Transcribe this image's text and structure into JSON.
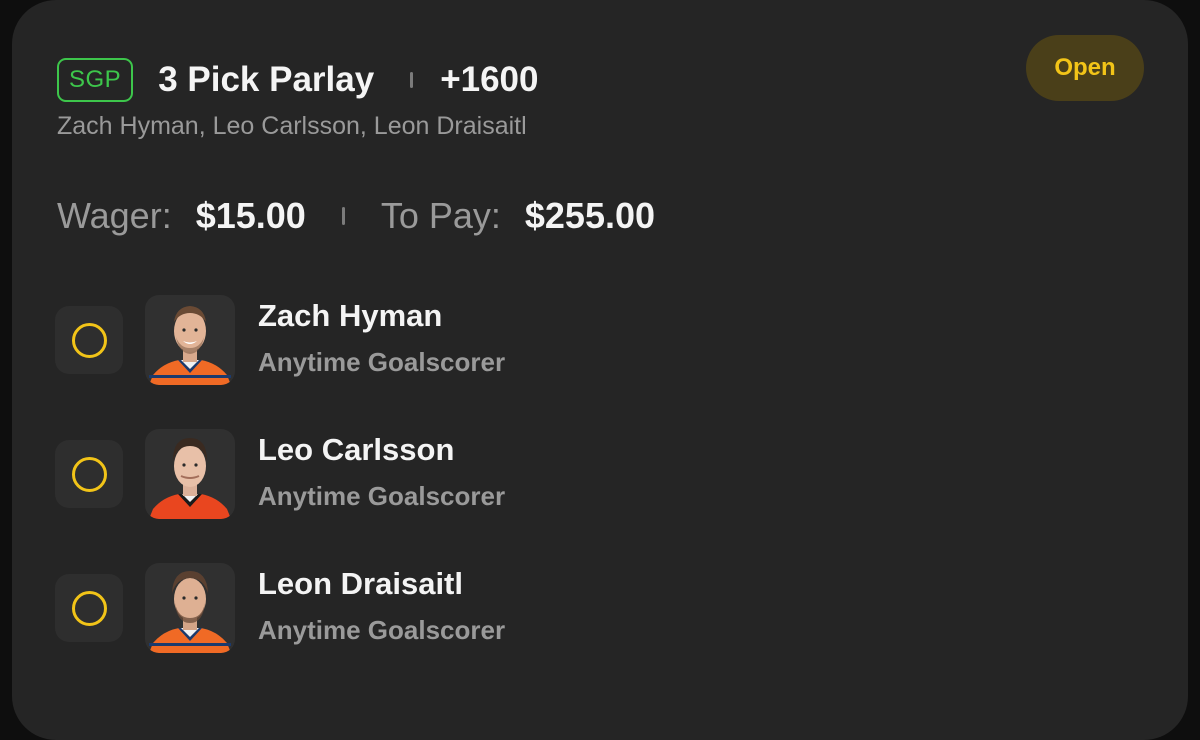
{
  "bet": {
    "badge": "SGP",
    "title": "3 Pick Parlay",
    "odds": "+1600",
    "players_summary": "Zach Hyman, Leo Carlsson, Leon Draisaitl",
    "status": "Open",
    "wager_label": "Wager:",
    "wager_value": "$15.00",
    "to_pay_label": "To Pay:",
    "to_pay_value": "$255.00"
  },
  "picks": [
    {
      "player": "Zach Hyman",
      "market": "Anytime Goalscorer",
      "avatar": "player-headshot-icon"
    },
    {
      "player": "Leo Carlsson",
      "market": "Anytime Goalscorer",
      "avatar": "player-headshot-icon"
    },
    {
      "player": "Leon Draisaitl",
      "market": "Anytime Goalscorer",
      "avatar": "player-headshot-icon"
    }
  ],
  "colors": {
    "card_bg": "#252525",
    "sgp_green": "#3dc64b",
    "pending_yellow": "#f2c418",
    "open_pill_bg": "#4a3f19",
    "oilers_orange": "#f06a25",
    "ducks_orange": "#e9461f",
    "oilers_navy": "#1b3a6d"
  }
}
